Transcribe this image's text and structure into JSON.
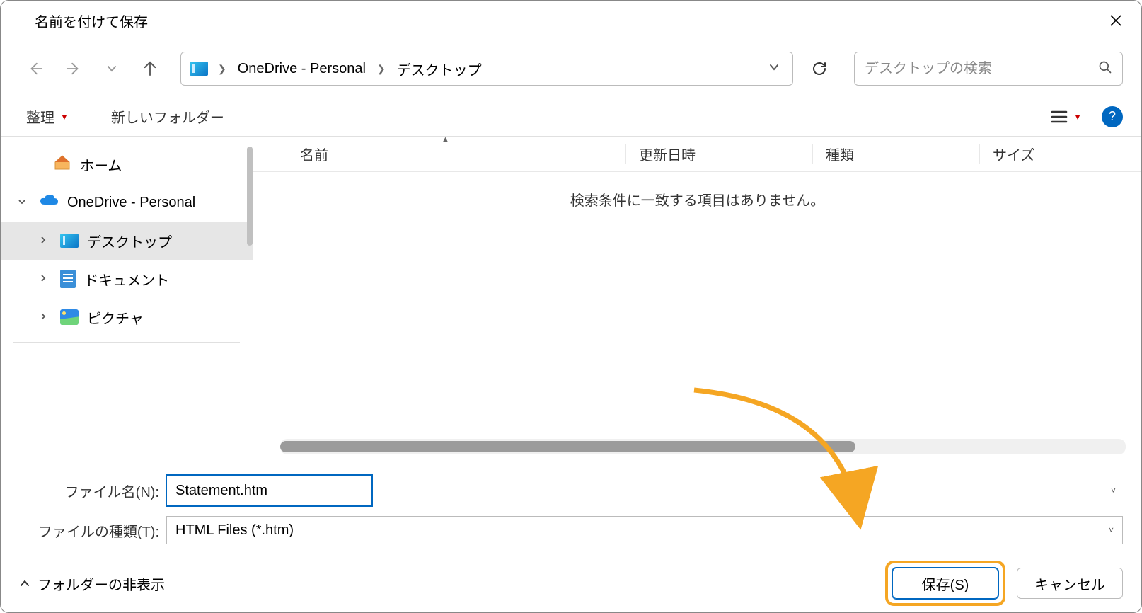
{
  "title": "名前を付けて保存",
  "breadcrumb": {
    "seg1": "OneDrive - Personal",
    "seg2": "デスクトップ"
  },
  "search": {
    "placeholder": "デスクトップの検索"
  },
  "toolbar": {
    "organize": "整理",
    "new_folder": "新しいフォルダー"
  },
  "columns": {
    "name": "名前",
    "date": "更新日時",
    "type": "種類",
    "size": "サイズ"
  },
  "sidebar": {
    "home": "ホーム",
    "onedrive": "OneDrive - Personal",
    "desktop": "デスクトップ",
    "documents": "ドキュメント",
    "pictures": "ピクチャ"
  },
  "empty_message": "検索条件に一致する項目はありません。",
  "filename_label": "ファイル名(N):",
  "filename_value": "Statement.htm",
  "filetype_label": "ファイルの種類(T):",
  "filetype_value": "HTML Files (*.htm)",
  "hide_folders": "フォルダーの非表示",
  "save_btn": "保存(S)",
  "cancel_btn": "キャンセル",
  "help_symbol": "?"
}
